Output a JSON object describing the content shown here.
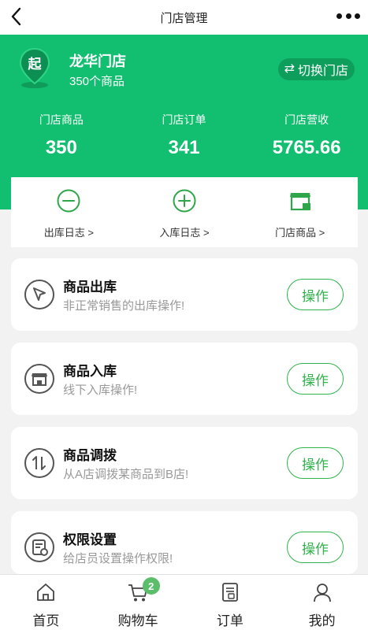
{
  "navbar": {
    "title": "门店管理",
    "back_icon": "chevron-left-icon",
    "more_icon": "more-dots-icon"
  },
  "store": {
    "logo_text": "起",
    "name": "龙华门店",
    "subtitle": "350个商品",
    "switch_icon": "⇄",
    "switch_label": "切换门店"
  },
  "stats": [
    {
      "label": "门店商品",
      "value": "350"
    },
    {
      "label": "门店订单",
      "value": "341"
    },
    {
      "label": "门店营收",
      "value": "5765.66"
    }
  ],
  "quick_links": [
    {
      "label": "出库日志 >",
      "icon": "minus-circle-icon"
    },
    {
      "label": "入库日志 >",
      "icon": "plus-circle-icon"
    },
    {
      "label": "门店商品 >",
      "icon": "shop-icon"
    }
  ],
  "actions": [
    {
      "title": "商品出库",
      "desc": "非正常销售的出库操作!",
      "button": "操作",
      "icon": "cursor-icon"
    },
    {
      "title": "商品入库",
      "desc": "线下入库操作!",
      "button": "操作",
      "icon": "store-icon"
    },
    {
      "title": "商品调拨",
      "desc": "从A店调拨某商品到B店!",
      "button": "操作",
      "icon": "transfer-icon"
    },
    {
      "title": "权限设置",
      "desc": "给店员设置操作权限!",
      "button": "操作",
      "icon": "permission-icon"
    }
  ],
  "tabbar": {
    "items": [
      {
        "label": "首页",
        "icon": "home-icon"
      },
      {
        "label": "购物车",
        "icon": "cart-icon",
        "badge": "2"
      },
      {
        "label": "订单",
        "icon": "order-icon"
      },
      {
        "label": "我的",
        "icon": "user-icon"
      }
    ]
  },
  "colors": {
    "brand_green": "#12be6f",
    "button_green": "#2fb34a",
    "badge_green": "#5cbd6b"
  }
}
